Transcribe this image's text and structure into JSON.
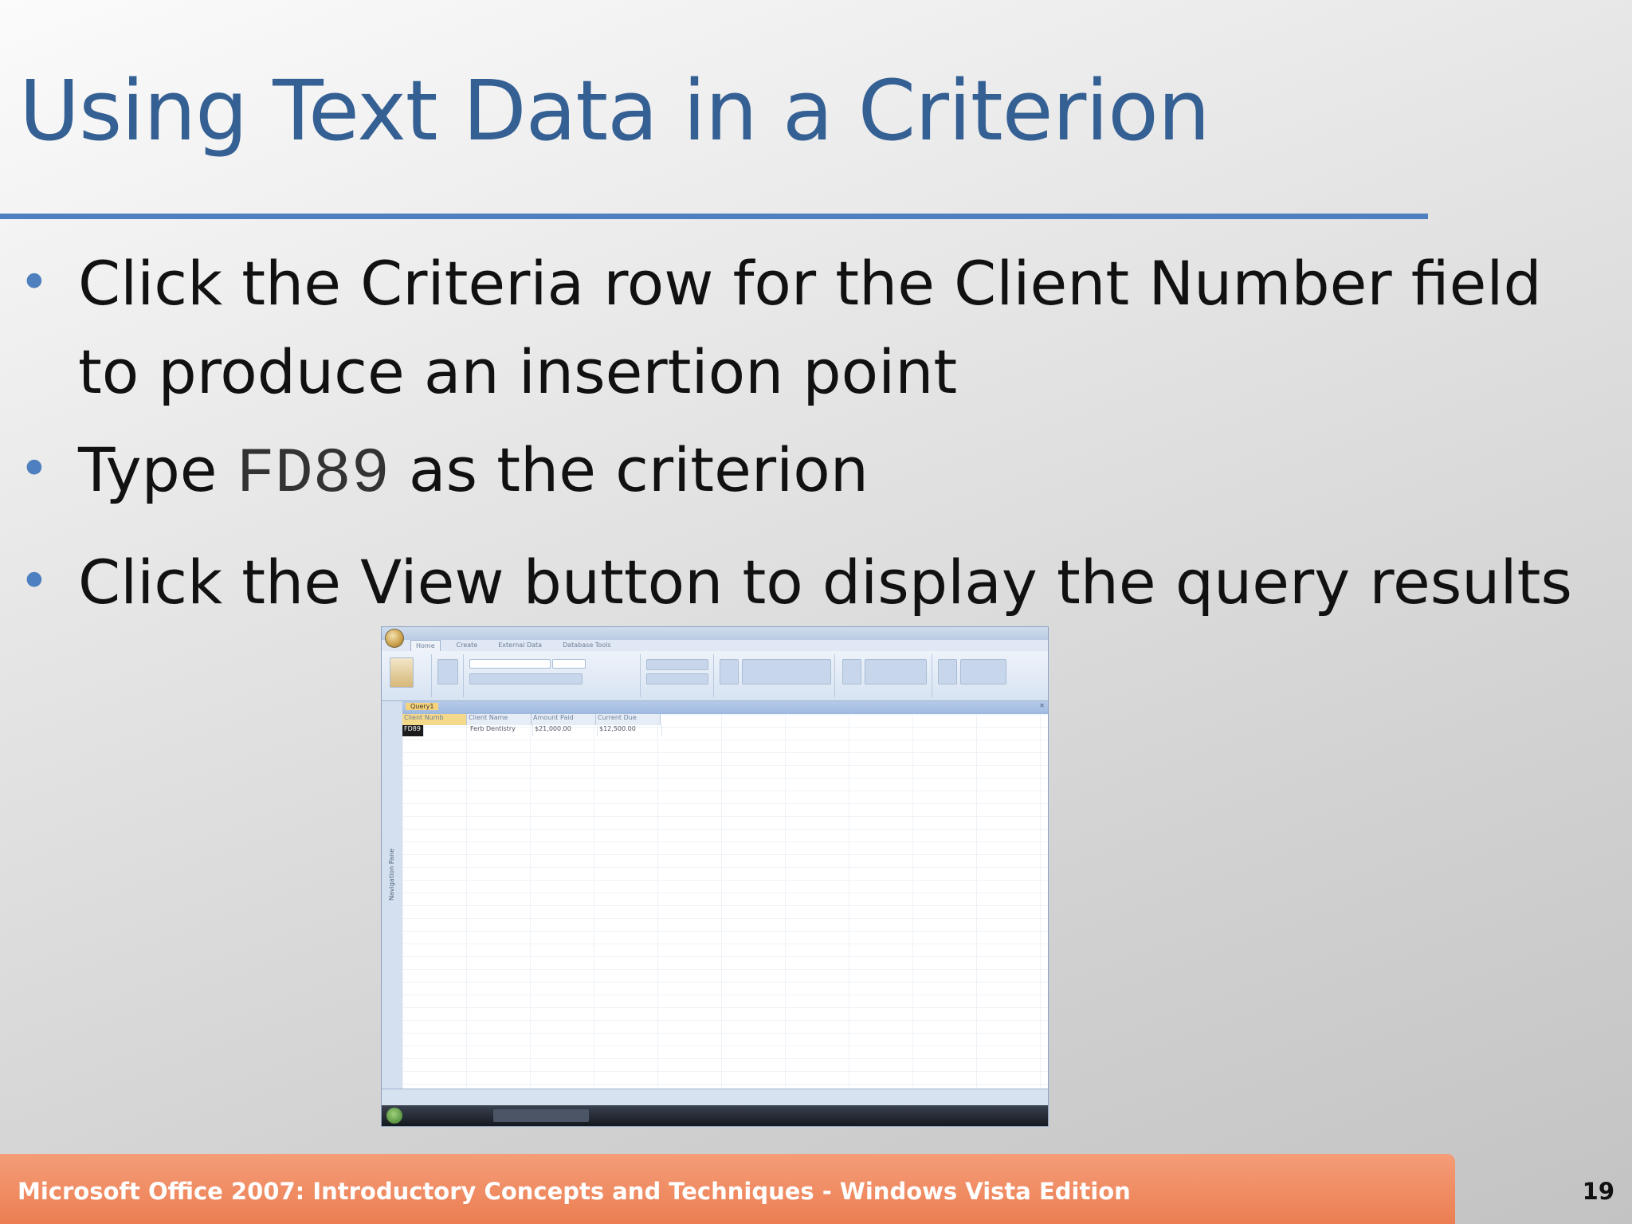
{
  "slide": {
    "title": "Using Text Data in a Criterion",
    "bullets": [
      {
        "text": "Click the Criteria row for the Client Number field to produce an insertion point"
      },
      {
        "pre": "Type ",
        "code": "FD89",
        "post": " as the criterion"
      },
      {
        "text": "Click the View button to display the query results"
      }
    ]
  },
  "screenshot": {
    "tabs": [
      "Home",
      "Create",
      "External Data",
      "Database Tools"
    ],
    "nav_pane_label": "Navigation Pane",
    "query_tab": "Query1",
    "columns": [
      "Client Numb",
      "Client Name",
      "Amount Paid",
      "Current Due"
    ],
    "row": [
      "FD89",
      "Ferb Dentistry",
      "$21,000.00",
      "$12,500.00"
    ]
  },
  "footer": {
    "text": "Microsoft Office 2007: Introductory Concepts and Techniques - Windows Vista Edition",
    "page_number": "19"
  },
  "colors": {
    "title": "#356093",
    "accent": "#4e7fbe",
    "footer": "#ec7e52"
  }
}
